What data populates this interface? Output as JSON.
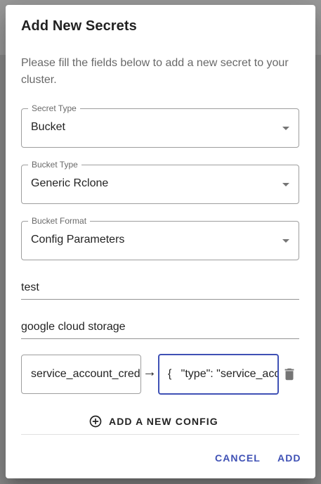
{
  "dialog": {
    "title": "Add New Secrets",
    "description": "Please fill the fields below to add a new secret to your cluster."
  },
  "fields": {
    "secret_type": {
      "label": "Secret Type",
      "value": "Bucket"
    },
    "bucket_type": {
      "label": "Bucket Type",
      "value": "Generic Rclone"
    },
    "bucket_format": {
      "label": "Bucket Format",
      "value": "Config Parameters"
    },
    "name": {
      "value": "test"
    },
    "description": {
      "value": "google cloud storage"
    }
  },
  "config": {
    "key": "service_account_credentials",
    "value": "{   \"type\": \"service_account\"",
    "arrow": "→"
  },
  "add_config_label": "ADD A NEW CONFIG",
  "actions": {
    "cancel": "CANCEL",
    "add": "ADD"
  },
  "colors": {
    "primary": "#3f51b5",
    "backdrop": "#8a8a8a"
  },
  "icons": {
    "add_config": "plus-circle-outline-icon",
    "delete": "trash-icon",
    "dropdown": "caret-down-icon"
  }
}
